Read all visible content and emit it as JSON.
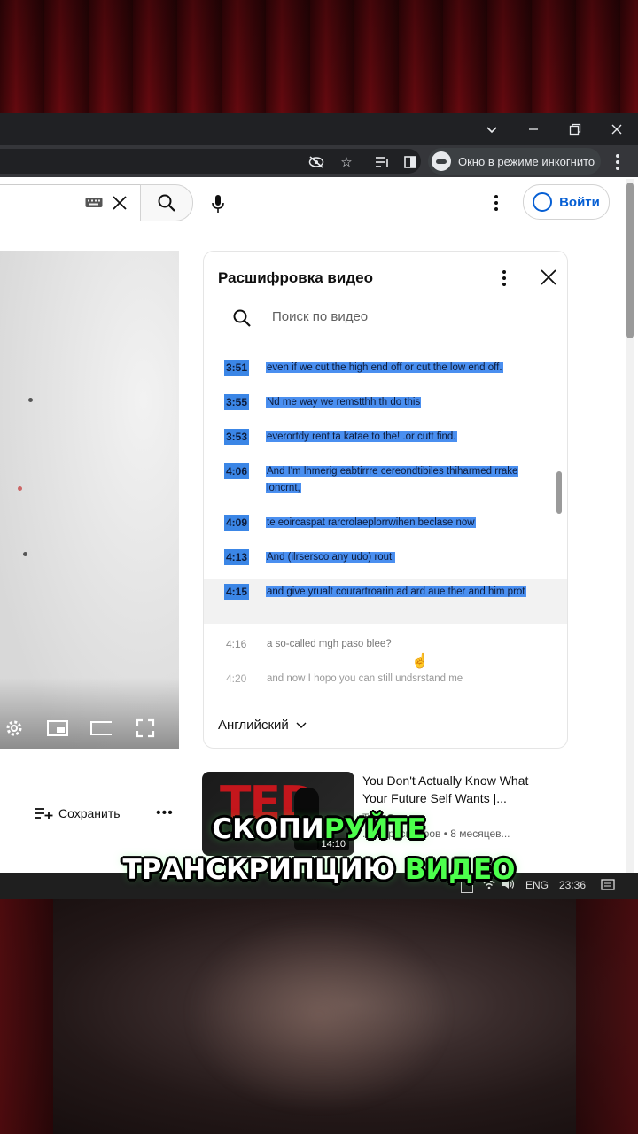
{
  "browser": {
    "incognito_label": "Окно в режиме инкогнито"
  },
  "youtube": {
    "signin_label": "Войти",
    "save_label": "Сохранить"
  },
  "transcript": {
    "title": "Расшифровка видео",
    "search_placeholder": "Поиск по видео",
    "language": "Английский",
    "segments": [
      {
        "time": "3:51",
        "text": "even if we cut the high end off or cut the low end off."
      },
      {
        "time": "3:55",
        "text": "Nd me way we remstthh th do this"
      },
      {
        "time": "3:53",
        "text": "everortdy rent ta katae to the! .or cutt find."
      },
      {
        "time": "4:06",
        "text": "And I'm lhmerig eabtirrre cereondtibiles thiharmed rrake loncrnt,"
      },
      {
        "time": "4:09",
        "text": "te eoircaspat rarcrolaeplorrwihen beclase now"
      },
      {
        "time": "4:13",
        "text": "And (ilrsersco any udo) routi"
      },
      {
        "time": "4:15",
        "text": "and give yrualt courartroarin ad ard aue ther and him prot"
      },
      {
        "time": "4:16",
        "text": "a so-called mgh paso blee?"
      },
      {
        "time": "4:20",
        "text": "and now I hopo you can still undsrstand me"
      }
    ]
  },
  "related": {
    "thumb_text": "TED",
    "duration": "14:10",
    "title": "You Don't Actually Know What Your Future Self Wants |...",
    "channel": "TED",
    "meta_views": "...с. просмотров",
    "meta_age": "8 месяцев..."
  },
  "taskbar": {
    "lang": "ENG",
    "time": "23:36"
  },
  "caption": {
    "line1_white": "СКОПИ",
    "line1_green": "РУЙТЕ",
    "line2_white": "ТРАНСКРИПЦИЮ ",
    "line2_green": "ВИДЕО"
  }
}
